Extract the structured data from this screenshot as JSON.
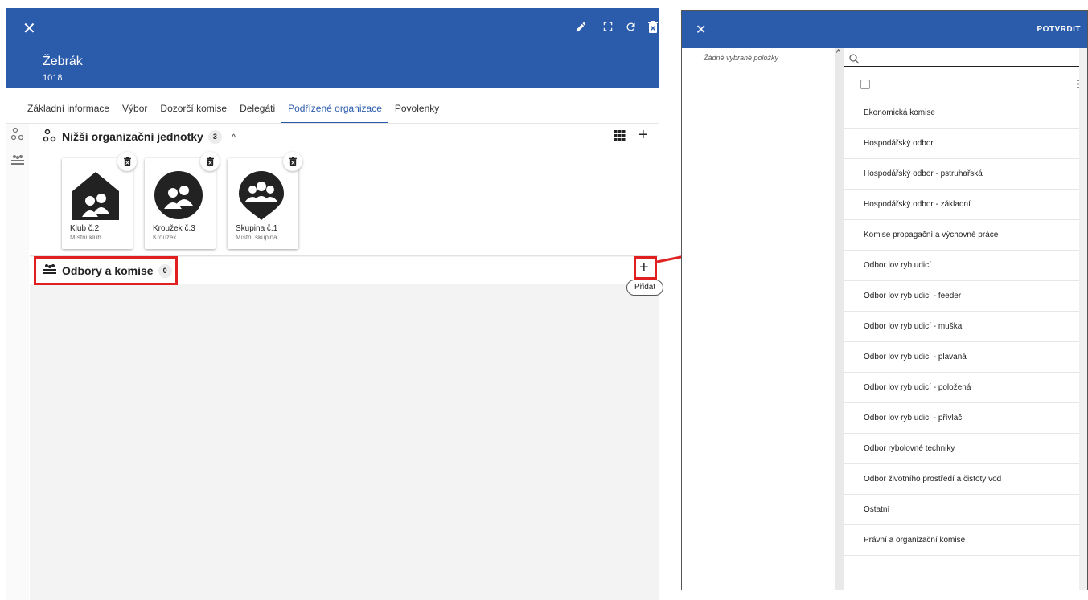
{
  "left": {
    "close_icon": "close-icon",
    "title": "Žebrák",
    "subtitle": "1018",
    "header_icons": [
      "pencil-icon",
      "fullscreen-icon",
      "refresh-icon",
      "delete-icon"
    ],
    "tabs": [
      {
        "label": "Základní informace",
        "active": false
      },
      {
        "label": "Výbor",
        "active": false
      },
      {
        "label": "Dozorčí komise",
        "active": false
      },
      {
        "label": "Delegáti",
        "active": false
      },
      {
        "label": "Podřízené organizace",
        "active": true
      },
      {
        "label": "Povolenky",
        "active": false
      }
    ],
    "section1": {
      "title": "Nižší organizační jednotky",
      "count": "3",
      "cards": [
        {
          "name": "Klub č.2",
          "type": "Místní klub",
          "icon": "house-group-icon"
        },
        {
          "name": "Kroužek č.3",
          "type": "Kroužek",
          "icon": "circle-group-icon"
        },
        {
          "name": "Skupina č.1",
          "type": "Místní skupina",
          "icon": "pin-group-icon"
        }
      ]
    },
    "section2": {
      "title": "Odbory a komise",
      "count": "0",
      "add_tooltip": "Přidat"
    }
  },
  "right": {
    "close_icon": "close-icon",
    "confirm_label": "POTVRDIT",
    "no_selection": "Žádné vybrané položky",
    "search_placeholder": "",
    "items": [
      "Ekonomická komise",
      "Hospodářský odbor",
      "Hospodářský odbor - pstruhařská",
      "Hospodářský odbor - základní",
      "Komise propagační a výchovné práce",
      "Odbor lov ryb udicí",
      "Odbor lov ryb udicí - feeder",
      "Odbor lov ryb udicí - muška",
      "Odbor lov ryb udicí - plavaná",
      "Odbor lov ryb udicí - položená",
      "Odbor lov ryb udicí - přívlač",
      "Odbor rybolovné techniky",
      "Odbor životního prostředí a čistoty vod",
      "Ostatní",
      "Právní a organizační komise"
    ]
  },
  "colors": {
    "primary": "#2b5bab",
    "annotation": "#e02020"
  }
}
